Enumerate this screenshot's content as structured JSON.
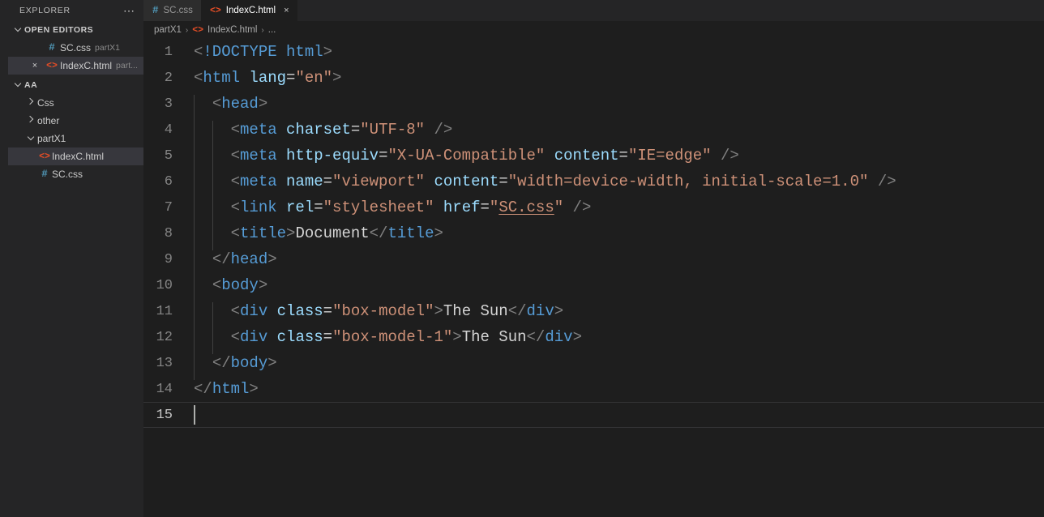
{
  "colors": {
    "editor_bg": "#1e1e1e",
    "sidebar_bg": "#252526",
    "tab_inactive_bg": "#2d2d2d",
    "selection_bg": "#37373d",
    "tag": "#569cd6",
    "attribute": "#9cdcfe",
    "string": "#ce9178",
    "punctuation": "#808080",
    "text": "#d4d4d4",
    "html_icon": "#e44d26",
    "css_icon": "#519aba"
  },
  "sidebar": {
    "title": "EXPLORER",
    "more_actions": "⋯",
    "open_editors": {
      "label": "OPEN EDITORS",
      "expanded": true,
      "items": [
        {
          "name": "SC.css",
          "description": "partX1",
          "icon": "css-file-icon",
          "icon_glyph": "#",
          "dirty": false,
          "selected": false
        },
        {
          "name": "IndexC.html",
          "description": "part...",
          "icon": "html-file-icon",
          "icon_glyph": "<>",
          "close_glyph": "×",
          "selected": true
        }
      ]
    },
    "workspace": {
      "label": "AA",
      "expanded": true,
      "tree": [
        {
          "name": "Css",
          "type": "folder",
          "expanded": false,
          "depth": 1
        },
        {
          "name": "other",
          "type": "folder",
          "expanded": false,
          "depth": 1
        },
        {
          "name": "partX1",
          "type": "folder",
          "expanded": true,
          "depth": 1
        },
        {
          "name": "IndexC.html",
          "type": "file",
          "icon": "html-file-icon",
          "icon_glyph": "<>",
          "depth": 2,
          "selected": true
        },
        {
          "name": "SC.css",
          "type": "file",
          "icon": "css-file-icon",
          "icon_glyph": "#",
          "depth": 2,
          "selected": false
        }
      ]
    }
  },
  "tabs": [
    {
      "label": "SC.css",
      "icon": "css-file-icon",
      "icon_glyph": "#",
      "active": false
    },
    {
      "label": "IndexC.html",
      "icon": "html-file-icon",
      "icon_glyph": "<>",
      "active": true,
      "close_glyph": "×"
    }
  ],
  "breadcrumb": {
    "items": [
      "partX1",
      "IndexC.html",
      "..."
    ],
    "file_icon_glyph": "<>",
    "separator": "›"
  },
  "code": {
    "language": "html",
    "total_lines": 15,
    "active_line": 15,
    "lines": [
      {
        "n": "1",
        "text": "<!DOCTYPE html>"
      },
      {
        "n": "2",
        "text": "<html lang=\"en\">"
      },
      {
        "n": "3",
        "text": "  <head>"
      },
      {
        "n": "4",
        "text": "    <meta charset=\"UTF-8\" />"
      },
      {
        "n": "5",
        "text": "    <meta http-equiv=\"X-UA-Compatible\" content=\"IE=edge\" />"
      },
      {
        "n": "6",
        "text": "    <meta name=\"viewport\" content=\"width=device-width, initial-scale=1.0\" />"
      },
      {
        "n": "7",
        "text": "    <link rel=\"stylesheet\" href=\"SC.css\" />"
      },
      {
        "n": "8",
        "text": "    <title>Document</title>"
      },
      {
        "n": "9",
        "text": "  </head>"
      },
      {
        "n": "10",
        "text": "  <body>"
      },
      {
        "n": "11",
        "text": "    <div class=\"box-model\">The Sun</div>"
      },
      {
        "n": "12",
        "text": "    <div class=\"box-model-1\">The Sun</div>"
      },
      {
        "n": "13",
        "text": "  </body>"
      },
      {
        "n": "14",
        "text": "</html>"
      },
      {
        "n": "15",
        "text": ""
      }
    ]
  }
}
